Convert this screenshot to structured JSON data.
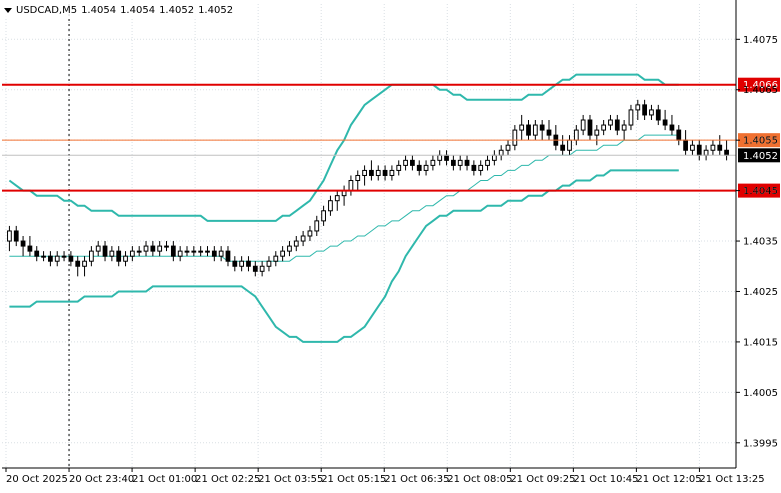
{
  "header": {
    "symbol_label": "USDCAD,M5",
    "open": "1.4054",
    "high": "1.4054",
    "low": "1.4052",
    "close": "1.4052",
    "dropdown_icon": "triangle-down-icon"
  },
  "colors": {
    "background": "#ffffff",
    "grid": "#d9dfe4",
    "candle": "#000000",
    "bollinger": "#2fb8ac",
    "ma": "#2fb8ac",
    "level_red": "#e00000",
    "level_orange": "#f07030",
    "price_label_bg": "#000000"
  },
  "chart_data": {
    "type": "candlestick",
    "symbol": "USDCAD",
    "timeframe": "M5",
    "ylim": [
      1.399,
      1.4082
    ],
    "y_ticks": [
      "1.4075",
      "1.4065",
      "1.4055",
      "1.4045",
      "1.4035",
      "1.4025",
      "1.4015",
      "1.4005",
      "1.3995"
    ],
    "x_ticks": [
      "20 Oct 2025",
      "20 Oct 23:40",
      "21 Oct 01:00",
      "21 Oct 02:25",
      "21 Oct 03:55",
      "21 Oct 05:15",
      "21 Oct 06:35",
      "21 Oct 08:05",
      "21 Oct 09:25",
      "21 Oct 10:45",
      "21 Oct 12:05",
      "21 Oct 13:25"
    ],
    "horizontal_levels": [
      {
        "price": 1.4066,
        "label": "1.4066",
        "color": "#e00000"
      },
      {
        "price": 1.4055,
        "label": "1.4055",
        "color": "#f07030"
      },
      {
        "price": 1.4045,
        "label": "1.4045",
        "color": "#e00000"
      }
    ],
    "current_price": {
      "price": 1.4052,
      "label": "1.4052"
    },
    "period_separator_tick": "20 Oct 23:40",
    "candles": [
      [
        1.4035,
        1.4038,
        1.4033,
        1.4037
      ],
      [
        1.4037,
        1.4038,
        1.4034,
        1.4035
      ],
      [
        1.4035,
        1.4036,
        1.4032,
        1.4034
      ],
      [
        1.4034,
        1.4036,
        1.4032,
        1.4033
      ],
      [
        1.4033,
        1.4034,
        1.4031,
        1.4032
      ],
      [
        1.4032,
        1.4033,
        1.4031,
        1.4032
      ],
      [
        1.4032,
        1.4033,
        1.403,
        1.4031
      ],
      [
        1.4031,
        1.4033,
        1.403,
        1.4032
      ],
      [
        1.4032,
        1.4033,
        1.4031,
        1.4032
      ],
      [
        1.4032,
        1.4033,
        1.403,
        1.4031
      ],
      [
        1.4031,
        1.4032,
        1.4028,
        1.403
      ],
      [
        1.403,
        1.4032,
        1.4028,
        1.4031
      ],
      [
        1.4031,
        1.4034,
        1.403,
        1.4033
      ],
      [
        1.4033,
        1.4035,
        1.4032,
        1.4034
      ],
      [
        1.4034,
        1.4035,
        1.4031,
        1.4032
      ],
      [
        1.4032,
        1.4034,
        1.4031,
        1.4033
      ],
      [
        1.4033,
        1.4034,
        1.403,
        1.4031
      ],
      [
        1.4031,
        1.4033,
        1.403,
        1.4032
      ],
      [
        1.4032,
        1.4034,
        1.4031,
        1.4033
      ],
      [
        1.4033,
        1.4034,
        1.4032,
        1.4033
      ],
      [
        1.4033,
        1.4035,
        1.4032,
        1.4034
      ],
      [
        1.4034,
        1.4035,
        1.4032,
        1.4033
      ],
      [
        1.4033,
        1.4035,
        1.4032,
        1.4034
      ],
      [
        1.4034,
        1.4035,
        1.4033,
        1.4034
      ],
      [
        1.4034,
        1.4035,
        1.4031,
        1.4032
      ],
      [
        1.4032,
        1.4034,
        1.4031,
        1.4033
      ],
      [
        1.4033,
        1.4034,
        1.4032,
        1.4033
      ],
      [
        1.4033,
        1.4034,
        1.4032,
        1.4033
      ],
      [
        1.4033,
        1.4034,
        1.4032,
        1.4033
      ],
      [
        1.4033,
        1.4034,
        1.4032,
        1.4033
      ],
      [
        1.4033,
        1.4034,
        1.4031,
        1.4032
      ],
      [
        1.4032,
        1.4034,
        1.4031,
        1.4033
      ],
      [
        1.4033,
        1.4034,
        1.403,
        1.4031
      ],
      [
        1.4031,
        1.4032,
        1.4029,
        1.403
      ],
      [
        1.403,
        1.4032,
        1.4029,
        1.4031
      ],
      [
        1.4031,
        1.4032,
        1.4029,
        1.403
      ],
      [
        1.403,
        1.4031,
        1.4028,
        1.4029
      ],
      [
        1.4029,
        1.4031,
        1.4028,
        1.403
      ],
      [
        1.403,
        1.4032,
        1.4029,
        1.4031
      ],
      [
        1.4031,
        1.4033,
        1.403,
        1.4032
      ],
      [
        1.4032,
        1.4034,
        1.4031,
        1.4033
      ],
      [
        1.4033,
        1.4035,
        1.4032,
        1.4034
      ],
      [
        1.4034,
        1.4036,
        1.4033,
        1.4035
      ],
      [
        1.4035,
        1.4037,
        1.4034,
        1.4036
      ],
      [
        1.4036,
        1.4038,
        1.4035,
        1.4037
      ],
      [
        1.4037,
        1.404,
        1.4036,
        1.4039
      ],
      [
        1.4039,
        1.4042,
        1.4038,
        1.4041
      ],
      [
        1.4041,
        1.4044,
        1.404,
        1.4043
      ],
      [
        1.4043,
        1.4045,
        1.4041,
        1.4044
      ],
      [
        1.4044,
        1.4046,
        1.4042,
        1.4045
      ],
      [
        1.4045,
        1.4048,
        1.4044,
        1.4047
      ],
      [
        1.4047,
        1.4049,
        1.4045,
        1.4048
      ],
      [
        1.4048,
        1.405,
        1.4046,
        1.4049
      ],
      [
        1.4049,
        1.4051,
        1.4047,
        1.4048
      ],
      [
        1.4048,
        1.405,
        1.4047,
        1.4049
      ],
      [
        1.4049,
        1.405,
        1.4047,
        1.4048
      ],
      [
        1.4048,
        1.405,
        1.4047,
        1.4049
      ],
      [
        1.4049,
        1.4051,
        1.4048,
        1.405
      ],
      [
        1.405,
        1.4052,
        1.4049,
        1.4051
      ],
      [
        1.4051,
        1.4052,
        1.4049,
        1.405
      ],
      [
        1.405,
        1.4051,
        1.4048,
        1.4049
      ],
      [
        1.4049,
        1.4051,
        1.4048,
        1.405
      ],
      [
        1.405,
        1.4052,
        1.4049,
        1.4051
      ],
      [
        1.4051,
        1.4053,
        1.405,
        1.4052
      ],
      [
        1.4052,
        1.4053,
        1.405,
        1.4051
      ],
      [
        1.4051,
        1.4052,
        1.4049,
        1.405
      ],
      [
        1.405,
        1.4052,
        1.4049,
        1.4051
      ],
      [
        1.4051,
        1.4052,
        1.4049,
        1.405
      ],
      [
        1.405,
        1.4051,
        1.4048,
        1.4049
      ],
      [
        1.4049,
        1.4051,
        1.4048,
        1.405
      ],
      [
        1.405,
        1.4052,
        1.4049,
        1.4051
      ],
      [
        1.4051,
        1.4053,
        1.405,
        1.4052
      ],
      [
        1.4052,
        1.4054,
        1.4051,
        1.4053
      ],
      [
        1.4053,
        1.4055,
        1.4052,
        1.4054
      ],
      [
        1.4054,
        1.4058,
        1.4053,
        1.4057
      ],
      [
        1.4057,
        1.406,
        1.4055,
        1.4058
      ],
      [
        1.4058,
        1.4059,
        1.4055,
        1.4056
      ],
      [
        1.4056,
        1.4059,
        1.4055,
        1.4058
      ],
      [
        1.4058,
        1.4059,
        1.4055,
        1.4057
      ],
      [
        1.4057,
        1.4059,
        1.4055,
        1.4056
      ],
      [
        1.4056,
        1.4058,
        1.4053,
        1.4054
      ],
      [
        1.4054,
        1.4056,
        1.4052,
        1.4053
      ],
      [
        1.4053,
        1.4056,
        1.4052,
        1.4055
      ],
      [
        1.4055,
        1.4058,
        1.4054,
        1.4057
      ],
      [
        1.4057,
        1.406,
        1.4056,
        1.4059
      ],
      [
        1.4059,
        1.406,
        1.4055,
        1.4056
      ],
      [
        1.4056,
        1.4058,
        1.4054,
        1.4057
      ],
      [
        1.4057,
        1.4059,
        1.4056,
        1.4058
      ],
      [
        1.4058,
        1.406,
        1.4057,
        1.4059
      ],
      [
        1.4059,
        1.406,
        1.4056,
        1.4057
      ],
      [
        1.4057,
        1.4059,
        1.4055,
        1.4058
      ],
      [
        1.4058,
        1.4062,
        1.4057,
        1.4061
      ],
      [
        1.4061,
        1.4063,
        1.4059,
        1.4062
      ],
      [
        1.4062,
        1.4063,
        1.4059,
        1.406
      ],
      [
        1.406,
        1.4062,
        1.4059,
        1.4061
      ],
      [
        1.4061,
        1.4062,
        1.4058,
        1.4059
      ],
      [
        1.4059,
        1.4061,
        1.4057,
        1.4058
      ],
      [
        1.4058,
        1.406,
        1.4056,
        1.4057
      ],
      [
        1.4057,
        1.4058,
        1.4054,
        1.4055
      ],
      [
        1.4055,
        1.4057,
        1.4052,
        1.4053
      ],
      [
        1.4053,
        1.4055,
        1.4052,
        1.4054
      ],
      [
        1.4054,
        1.4055,
        1.4051,
        1.4052
      ],
      [
        1.4052,
        1.4054,
        1.4051,
        1.4053
      ],
      [
        1.4053,
        1.4055,
        1.4052,
        1.4054
      ],
      [
        1.4054,
        1.4056,
        1.4052,
        1.4053
      ],
      [
        1.4053,
        1.4055,
        1.4051,
        1.4052
      ]
    ],
    "bollinger_upper": [
      1.4047,
      1.4046,
      1.4045,
      1.4045,
      1.4044,
      1.4044,
      1.4044,
      1.4044,
      1.4043,
      1.4043,
      1.4042,
      1.4042,
      1.4041,
      1.4041,
      1.4041,
      1.4041,
      1.404,
      1.404,
      1.404,
      1.404,
      1.404,
      1.404,
      1.404,
      1.404,
      1.404,
      1.404,
      1.404,
      1.404,
      1.404,
      1.4039,
      1.4039,
      1.4039,
      1.4039,
      1.4039,
      1.4039,
      1.4039,
      1.4039,
      1.4039,
      1.4039,
      1.4039,
      1.404,
      1.404,
      1.4041,
      1.4042,
      1.4043,
      1.4045,
      1.4047,
      1.405,
      1.4053,
      1.4055,
      1.4058,
      1.406,
      1.4062,
      1.4063,
      1.4064,
      1.4065,
      1.4066,
      1.4066,
      1.4066,
      1.4066,
      1.4066,
      1.4066,
      1.4066,
      1.4065,
      1.4065,
      1.4064,
      1.4064,
      1.4063,
      1.4063,
      1.4063,
      1.4063,
      1.4063,
      1.4063,
      1.4063,
      1.4063,
      1.4063,
      1.4064,
      1.4064,
      1.4064,
      1.4065,
      1.4066,
      1.4067,
      1.4067,
      1.4068,
      1.4068,
      1.4068,
      1.4068,
      1.4068,
      1.4068,
      1.4068,
      1.4068,
      1.4068,
      1.4068,
      1.4067,
      1.4067,
      1.4067,
      1.4066,
      1.4066,
      1.4066
    ],
    "bollinger_middle": [
      1.4032,
      1.4032,
      1.4032,
      1.4032,
      1.4032,
      1.4032,
      1.4032,
      1.4032,
      1.4032,
      1.4032,
      1.4032,
      1.4032,
      1.4032,
      1.4032,
      1.4032,
      1.4032,
      1.4032,
      1.4032,
      1.4032,
      1.4032,
      1.4032,
      1.4032,
      1.4032,
      1.4032,
      1.4032,
      1.4032,
      1.4032,
      1.4032,
      1.4032,
      1.4032,
      1.4032,
      1.4032,
      1.4031,
      1.4031,
      1.4031,
      1.4031,
      1.4031,
      1.4031,
      1.4031,
      1.4031,
      1.4031,
      1.4031,
      1.4032,
      1.4032,
      1.4032,
      1.4033,
      1.4033,
      1.4034,
      1.4034,
      1.4035,
      1.4035,
      1.4036,
      1.4036,
      1.4037,
      1.4038,
      1.4038,
      1.4039,
      1.4039,
      1.404,
      1.4041,
      1.4041,
      1.4042,
      1.4042,
      1.4043,
      1.4044,
      1.4044,
      1.4045,
      1.4045,
      1.4046,
      1.4047,
      1.4047,
      1.4048,
      1.4048,
      1.4049,
      1.4049,
      1.405,
      1.405,
      1.4051,
      1.4051,
      1.4052,
      1.4052,
      1.4052,
      1.4052,
      1.4053,
      1.4053,
      1.4053,
      1.4053,
      1.4054,
      1.4054,
      1.4054,
      1.4055,
      1.4055,
      1.4055,
      1.4056,
      1.4056,
      1.4056,
      1.4056,
      1.4056,
      1.4056
    ],
    "bollinger_lower": [
      1.4022,
      1.4022,
      1.4022,
      1.4022,
      1.4023,
      1.4023,
      1.4023,
      1.4023,
      1.4023,
      1.4023,
      1.4023,
      1.4024,
      1.4024,
      1.4024,
      1.4024,
      1.4024,
      1.4025,
      1.4025,
      1.4025,
      1.4025,
      1.4025,
      1.4026,
      1.4026,
      1.4026,
      1.4026,
      1.4026,
      1.4026,
      1.4026,
      1.4026,
      1.4026,
      1.4026,
      1.4026,
      1.4026,
      1.4026,
      1.4026,
      1.4025,
      1.4024,
      1.4022,
      1.402,
      1.4018,
      1.4017,
      1.4016,
      1.4016,
      1.4015,
      1.4015,
      1.4015,
      1.4015,
      1.4015,
      1.4015,
      1.4016,
      1.4016,
      1.4017,
      1.4018,
      1.402,
      1.4022,
      1.4024,
      1.4027,
      1.4029,
      1.4032,
      1.4034,
      1.4036,
      1.4038,
      1.4039,
      1.404,
      1.404,
      1.4041,
      1.4041,
      1.4041,
      1.4041,
      1.4041,
      1.4042,
      1.4042,
      1.4042,
      1.4043,
      1.4043,
      1.4043,
      1.4044,
      1.4044,
      1.4044,
      1.4045,
      1.4045,
      1.4046,
      1.4046,
      1.4047,
      1.4047,
      1.4047,
      1.4048,
      1.4048,
      1.4049,
      1.4049,
      1.4049,
      1.4049,
      1.4049,
      1.4049,
      1.4049,
      1.4049,
      1.4049,
      1.4049,
      1.4049
    ]
  }
}
